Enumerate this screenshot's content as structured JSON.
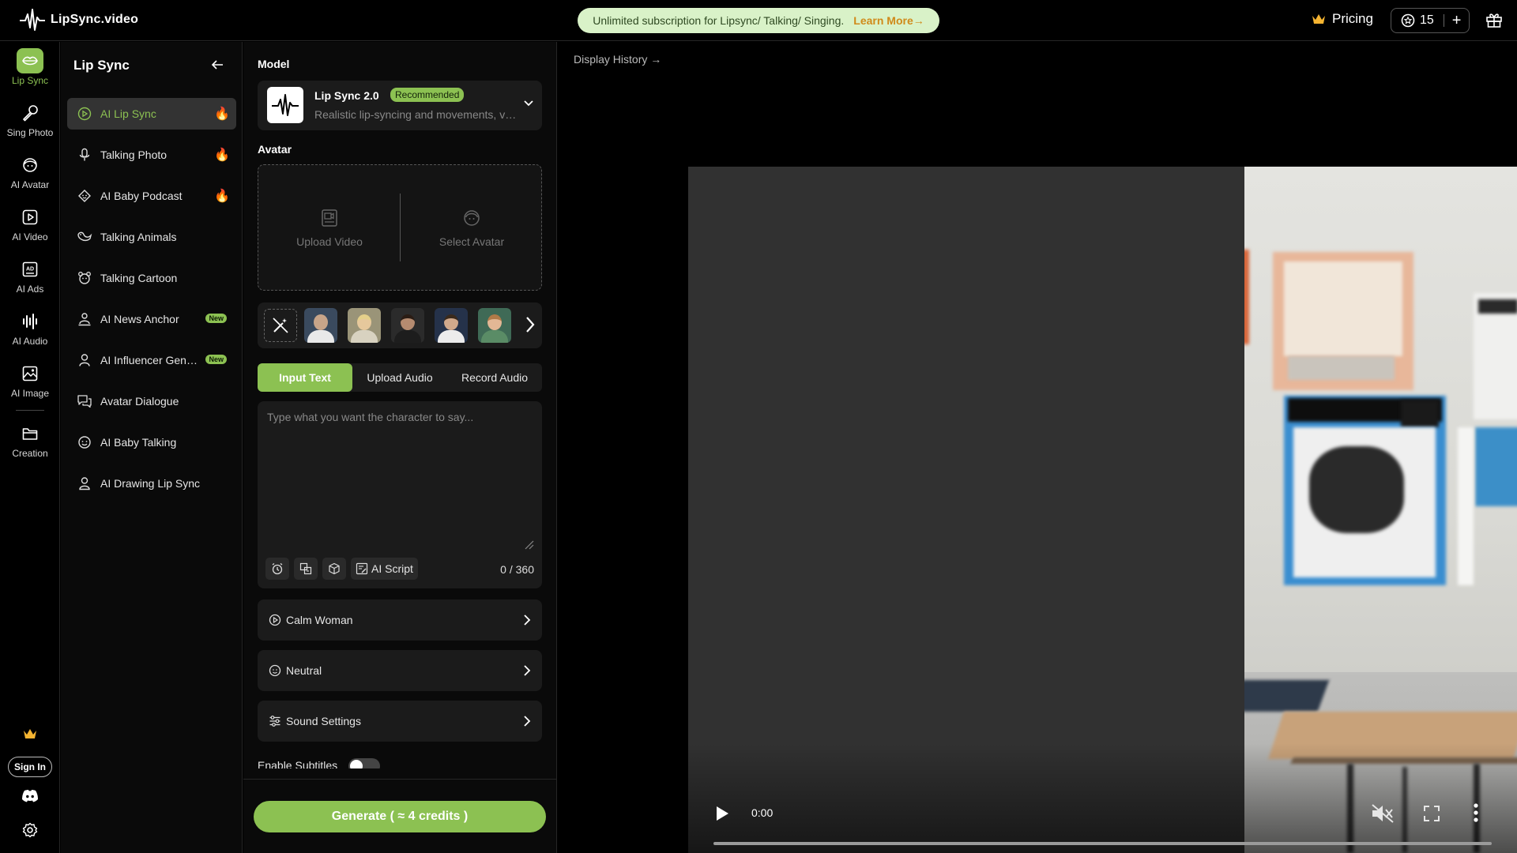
{
  "brand": {
    "name": "LipSync.video"
  },
  "promo": {
    "text": "Unlimited subscription for Lipsync/ Talking/ Singing.",
    "link": "Learn More→"
  },
  "header": {
    "pricing": "Pricing",
    "credits": "15",
    "add": "+"
  },
  "rail": {
    "items": [
      {
        "label": "Lip Sync",
        "icon": "lips-icon"
      },
      {
        "label": "Sing Photo",
        "icon": "microphone-icon"
      },
      {
        "label": "AI Avatar",
        "icon": "avatar-icon"
      },
      {
        "label": "AI Video",
        "icon": "video-play-icon"
      },
      {
        "label": "AI Ads",
        "icon": "ads-icon"
      },
      {
        "label": "AI Audio",
        "icon": "audio-wave-icon"
      },
      {
        "label": "AI Image",
        "icon": "image-icon"
      },
      {
        "label": "Creation",
        "icon": "folder-icon"
      }
    ],
    "signin": "Sign In"
  },
  "sidebar": {
    "title": "Lip Sync",
    "items": [
      {
        "label": "AI Lip Sync",
        "badge": "fire"
      },
      {
        "label": "Talking Photo",
        "badge": "fire"
      },
      {
        "label": "AI Baby Podcast",
        "badge": "fire"
      },
      {
        "label": "Talking Animals",
        "badge": ""
      },
      {
        "label": "Talking Cartoon",
        "badge": ""
      },
      {
        "label": "AI News Anchor",
        "badge": "New"
      },
      {
        "label": "AI Influencer Generator",
        "badge": "New"
      },
      {
        "label": "Avatar Dialogue",
        "badge": ""
      },
      {
        "label": "AI Baby Talking",
        "badge": ""
      },
      {
        "label": "AI Drawing Lip Sync",
        "badge": ""
      }
    ],
    "fire_glyph": "🔥"
  },
  "panel": {
    "model_label": "Model",
    "model_name": "Lip Sync 2.0",
    "model_badge": "Recommended",
    "model_desc": "Realistic lip-syncing and movements, very natural",
    "avatar_label": "Avatar",
    "upload_video": "Upload Video",
    "select_avatar": "Select Avatar",
    "tabs": [
      "Input Text",
      "Upload Audio",
      "Record Audio"
    ],
    "text_placeholder": "Type what you want the character to say...",
    "ai_script": "AI Script",
    "char_count": "0 / 360",
    "voice": "Calm Woman",
    "emotion": "Neutral",
    "sound_settings": "Sound Settings",
    "subtitles": "Enable Subtitles",
    "generate": "Generate ( ≈ 4 credits )"
  },
  "preview": {
    "history": "Display History →",
    "time": "0:00"
  },
  "colors": {
    "accent": "#8cc152",
    "promo_bg": "#d9f2c8",
    "promo_link": "#d08a1a"
  }
}
